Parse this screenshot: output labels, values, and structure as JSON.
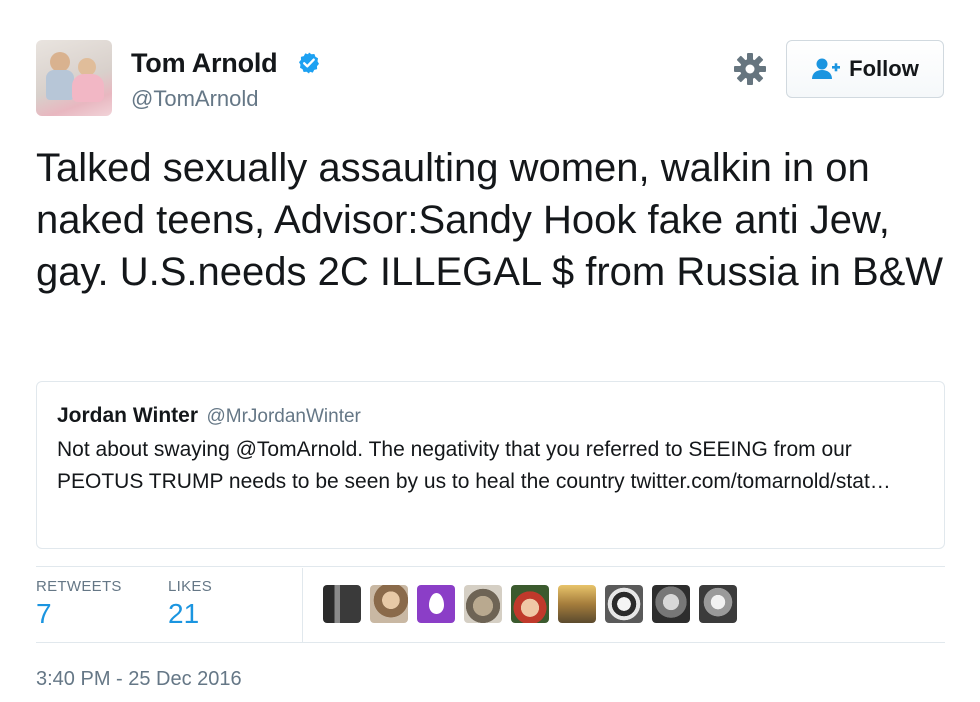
{
  "author": {
    "name": "Tom Arnold",
    "handle": "@TomArnold",
    "verified": true,
    "avatar_icon": "profile-photo"
  },
  "actions": {
    "settings_icon": "gear-icon",
    "follow_label": "Follow",
    "follow_icon": "add-user-icon"
  },
  "tweet": {
    "text": "Talked sexually assaulting women, walkin in on naked teens, Advisor:Sandy Hook fake anti Jew, gay. U.S.needs 2C ILLEGAL $ from Russia in B&W"
  },
  "quoted": {
    "name": "Jordan Winter",
    "handle": "@MrJordanWinter",
    "text": "Not about swaying @TomArnold. The negativity that you referred to SEEING from our PEOTUS TRUMP needs to be seen by us to heal the country twitter.com/tomarnold/stat…"
  },
  "stats": {
    "retweets_label": "RETWEETS",
    "retweets_value": "7",
    "likes_label": "LIKES",
    "likes_value": "21"
  },
  "likers": [
    {
      "icon": "liker-avatar-1"
    },
    {
      "icon": "liker-avatar-2"
    },
    {
      "icon": "liker-avatar-egg"
    },
    {
      "icon": "liker-avatar-cat"
    },
    {
      "icon": "liker-avatar-5"
    },
    {
      "icon": "liker-avatar-6"
    },
    {
      "icon": "liker-avatar-dog"
    },
    {
      "icon": "liker-avatar-8"
    },
    {
      "icon": "liker-avatar-9"
    }
  ],
  "timestamp": "3:40 PM - 25 Dec 2016",
  "colors": {
    "accent": "#1b95e0",
    "verified": "#1da1f2",
    "muted": "#657786",
    "border": "#e1e8ed",
    "egg": "#8b3ec7"
  }
}
